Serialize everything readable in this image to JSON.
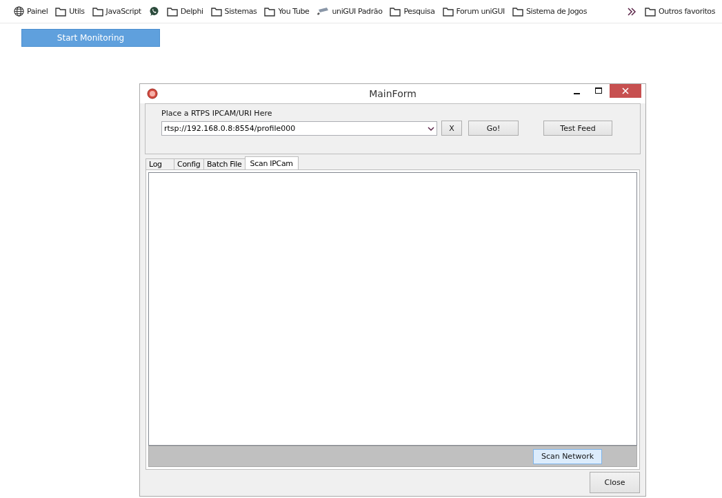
{
  "bookmarks": [
    {
      "kind": "globe",
      "label": "Painel"
    },
    {
      "kind": "folder",
      "label": "Utils"
    },
    {
      "kind": "folder",
      "label": "JavaScript"
    },
    {
      "kind": "chat"
    },
    {
      "kind": "folder",
      "label": "Delphi"
    },
    {
      "kind": "folder",
      "label": "Sistemas"
    },
    {
      "kind": "folder",
      "label": "You Tube"
    },
    {
      "kind": "camera",
      "label": "uniGUI Padrão"
    },
    {
      "kind": "folder",
      "label": "Pesquisa"
    },
    {
      "kind": "folder",
      "label": "Forum uniGUI"
    },
    {
      "kind": "folder",
      "label": "Sistema de Jogos"
    }
  ],
  "other_bookmarks": {
    "label": "Outros favoritos"
  },
  "start_button": "Start Monitoring",
  "window": {
    "title": "MainForm",
    "url_label": "Place a RTPS IPCAM/URI  Here",
    "url_value": "rtsp://192.168.0.8:8554/profile000",
    "buttons": [
      "X",
      "Go!",
      "Test Feed"
    ],
    "tabs": [
      {
        "label": "Log",
        "selected": false
      },
      {
        "label": "Config",
        "selected": false
      },
      {
        "label": "Batch File",
        "selected": false
      },
      {
        "label": "Scan IPCam",
        "selected": true
      }
    ],
    "scan_button": "Scan Network",
    "close_button": "Close"
  }
}
